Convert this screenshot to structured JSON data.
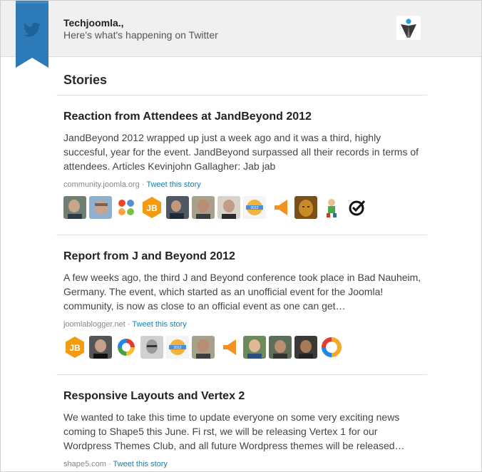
{
  "header": {
    "title": "Techjoomla.,",
    "subtitle": "Here's what's happening on Twitter",
    "ribbon_icon": "twitter-bird-icon",
    "logo_icon": "techjoomla-logo-icon"
  },
  "section": {
    "title": "Stories"
  },
  "colors": {
    "ribbon": "#2d7ab9",
    "link": "#1a7fa8",
    "header_bg": "#f0f0f0"
  },
  "stories": [
    {
      "title": "Reaction from Attendees at JandBeyond 2012",
      "body": "JandBeyond 2012 wrapped up just a week ago and it was a third, highly succesful, year for the event. JandBeyond surpassed all their records in terms of attendees. Articles Kevinjohn Gallagher: Jab jab",
      "source": "community.joomla.org",
      "separator": " · ",
      "tweet_label": "Tweet this story",
      "avatars": [
        "person-avatar",
        "person-avatar",
        "joomla-logo-icon",
        "jb-badge-icon",
        "person-avatar",
        "person-avatar",
        "person-avatar",
        "jab2012-badge-icon",
        "megaphone-icon",
        "statue-avatar",
        "character-avatar",
        "check-circle-icon"
      ]
    },
    {
      "title": "Report from J and Beyond 2012",
      "body": "A few weeks ago, the third J and Beyond conference took place in Bad Nauheim, Germany. The event, which started as an unofficial event for the Joomla! community, is now as close to an official event as one can get…",
      "source": "joomlablogger.net",
      "separator": " · ",
      "tweet_label": "Tweet this story",
      "avatars": [
        "jb-badge-icon",
        "person-avatar",
        "swirl-logo-icon",
        "person-avatar",
        "jab2012-badge-icon",
        "person-avatar",
        "megaphone-icon",
        "person-avatar",
        "person-avatar",
        "person-avatar",
        "ring-logo-icon"
      ]
    },
    {
      "title": "Responsive Layouts and Vertex 2",
      "body": "We wanted to take this time to update everyone on some very exciting news coming to Shape5 this June. Fi rst, we will be releasing Vertex 1 for our Wordpress Themes Club, and all future Wordpress themes will be released…",
      "source": "shape5.com",
      "separator": " · ",
      "tweet_label": "Tweet this story",
      "avatars": []
    }
  ]
}
